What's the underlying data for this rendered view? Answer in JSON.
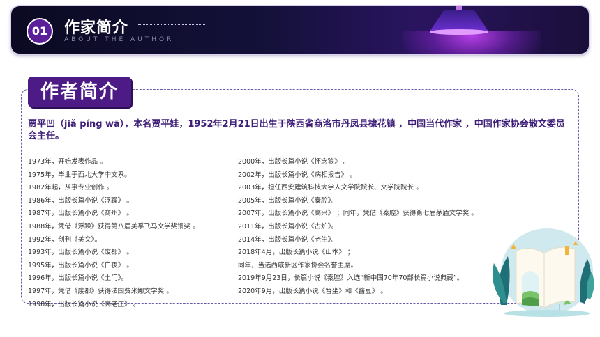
{
  "header": {
    "number": "01",
    "title": "作家简介",
    "subtitle": "ABOUT THE AUTHOR"
  },
  "section": {
    "tag": "作者简介",
    "intro": "贾平凹（jiǎ píng wā），本名贾平娃，1952年2月21日出生于陕西省商洛市丹凤县棣花镇 ，中国当代作家 ，中国作家协会散文委员会主任。",
    "timeline_left": [
      "1973年，开始发表作品 。",
      "1975年，毕业于西北大学中文系。",
      "1982年起，从事专业创作 。",
      "1986年，出版长篇小说《浮躁》 。",
      "1987年，出版长篇小说《商州》 。",
      "1988年，凭借《浮躁》获得第八届美孚飞马文学奖铜奖 。",
      "1992年，创刊《美文》。",
      "1993年，出版长篇小说《废都》 。",
      "1995年，出版长篇小说《白夜》 。",
      "1996年，出版长篇小说《土门》。",
      "1997年，凭借《废都》获得法国费米娜文学奖 。",
      "1998年，出版长篇小说《高老庄》 。"
    ],
    "timeline_right": [
      "2000年，出版长篇小说《怀念狼》 。",
      "2002年，出版长篇小说《病相报告》 。",
      "2003年，担任西安建筑科技大学人文学院院长、文学院院长 。",
      "2005年，出版长篇小说《秦腔》。",
      "2007年，出版长篇小说《高兴》 ；同年，凭借《秦腔》获得第七届茅盾文学奖 。",
      "2011年，出版长篇小说《古炉》。",
      "2014年，出版长篇小说《老生》。",
      "2018年4月，出版长篇小说《山本》 ；",
      "同年，当选西咸新区作家协会名誉主席。",
      "2019年9月23日，长篇小说《秦腔》入选“新中国70年70部长篇小说典藏”。",
      "2020年9月，出版长篇小说《暂坐》和《酱豆》 。"
    ]
  },
  "colors": {
    "accent": "#4d1b86",
    "banner_bg": "#0b0a22",
    "intro_text": "#3d1d78"
  },
  "icons": {
    "lamp": "hanging-lamp-icon",
    "book": "open-book-illustration"
  }
}
